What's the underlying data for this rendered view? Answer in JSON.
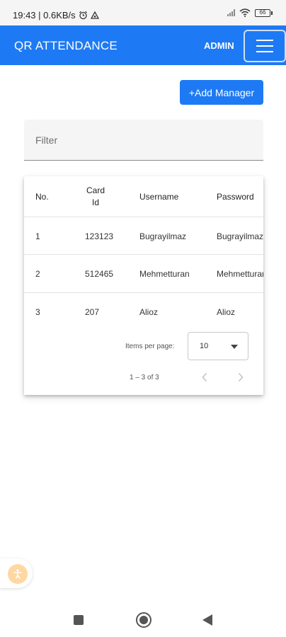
{
  "status_bar": {
    "time_speed": "19:43 | 0.6KB/s",
    "battery": "66"
  },
  "app_bar": {
    "title": "QR ATTENDANCE",
    "role": "ADMIN"
  },
  "actions": {
    "add_manager_label": "+Add Manager"
  },
  "filter": {
    "placeholder": "Filter",
    "value": ""
  },
  "table": {
    "columns": [
      "No.",
      "Card Id",
      "Username",
      "Password"
    ],
    "rows": [
      [
        "1",
        "123123",
        "Bugrayilmaz",
        "Bugrayilmaz"
      ],
      [
        "2",
        "512465",
        "Mehmetturan",
        "Mehmetturan"
      ],
      [
        "3",
        "207",
        "Alioz",
        "Alioz"
      ]
    ]
  },
  "paginator": {
    "items_per_page_label": "Items per page:",
    "items_per_page_value": "10",
    "range_label": "1 – 3 of 3"
  },
  "colors": {
    "primary": "#1e7af4",
    "accessibility": "#ffd7a0"
  }
}
